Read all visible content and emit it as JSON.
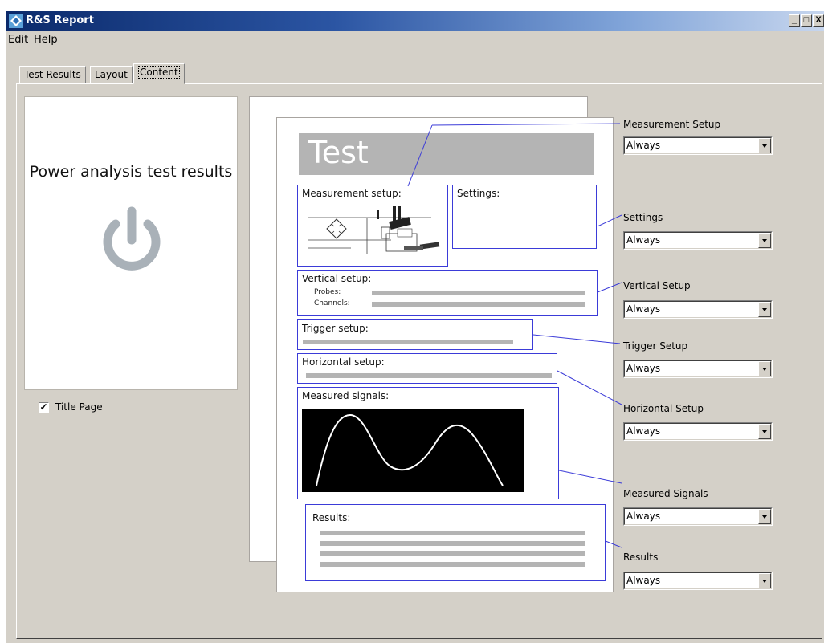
{
  "window": {
    "title": "R&S Report",
    "controls": [
      "_",
      "□",
      "X"
    ]
  },
  "menu": [
    "Edit",
    "Help"
  ],
  "tabs": [
    "Test Results",
    "Layout",
    "Content"
  ],
  "active_tab": "Content",
  "title_page": {
    "heading": "Power analysis test results",
    "icon": "power-icon",
    "checkbox_label": "Title Page",
    "checked": true
  },
  "preview": {
    "banner": "Test",
    "sections": {
      "measurement_setup": "Measurement setup:",
      "settings": "Settings:",
      "vertical_setup": "Vertical setup:",
      "probes": "Probes:",
      "channels": "Channels:",
      "trigger_setup": "Trigger setup:",
      "horizontal_setup": "Horizontal setup:",
      "measured_signals": "Measured signals:",
      "results": "Results:"
    }
  },
  "options": [
    {
      "label": "Measurement Setup",
      "value": "Always"
    },
    {
      "label": "Settings",
      "value": "Always"
    },
    {
      "label": "Vertical Setup",
      "value": "Always"
    },
    {
      "label": "Trigger Setup",
      "value": "Always"
    },
    {
      "label": "Horizontal Setup",
      "value": "Always"
    },
    {
      "label": "Measured Signals",
      "value": "Always"
    },
    {
      "label": "Results",
      "value": "Always"
    }
  ],
  "colors": {
    "accent": "#3b3bd8",
    "panel": "#d4d0c8",
    "placeholder": "#b4b4b4"
  }
}
